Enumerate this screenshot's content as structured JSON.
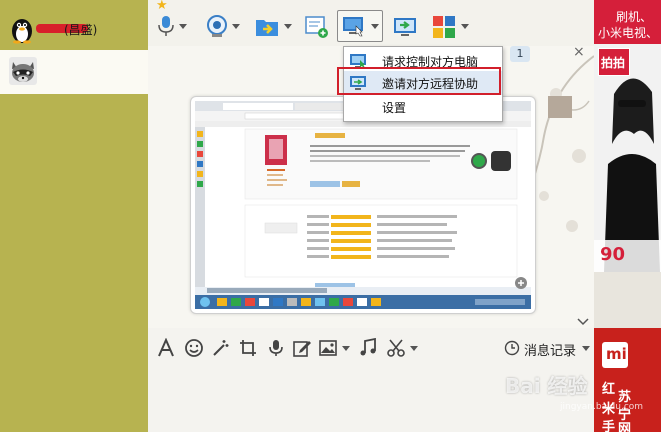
{
  "contacts": [
    {
      "name": "(昌盛)"
    },
    {
      "name": ""
    }
  ],
  "toolbar": {
    "icons": [
      "star-icon",
      "microphone-icon",
      "webcam-icon",
      "send-file-icon",
      "message-add-icon",
      "remote-desktop-icon",
      "share-screen-icon",
      "apps-icon"
    ]
  },
  "chat": {
    "badge": "1"
  },
  "menu": {
    "items": [
      {
        "label": "请求控制对方电脑",
        "icon": "remote-request-icon"
      },
      {
        "label": "邀请对方远程协助",
        "icon": "remote-invite-icon"
      },
      {
        "label": "设置",
        "icon": ""
      }
    ]
  },
  "input_toolbar": {
    "icons": [
      "font-icon",
      "emoji-icon",
      "magic-wand-icon",
      "screenshot-icon",
      "voice-icon",
      "edit-icon",
      "image-icon",
      "music-icon",
      "scissors-icon"
    ],
    "history_label": "消息记录"
  },
  "ads": {
    "top_line1": "刷机、",
    "top_line2": "小米电视、",
    "top_badge": "拍拍",
    "top_price": "90",
    "bottom_logo": "mi",
    "bottom_line1": "红",
    "bottom_line2": "苏",
    "bottom_line3": "米",
    "bottom_line4": "宁",
    "bottom_line5": "手",
    "bottom_line6": "网"
  },
  "watermark": {
    "text": "Bai 经验",
    "sub": "jingyan.baidu.com"
  },
  "colors": {
    "panel": "#b7b350",
    "highlight": "#d21f2b",
    "menu_hover": "#dfe9f5",
    "ad_red": "#d51f3a"
  }
}
